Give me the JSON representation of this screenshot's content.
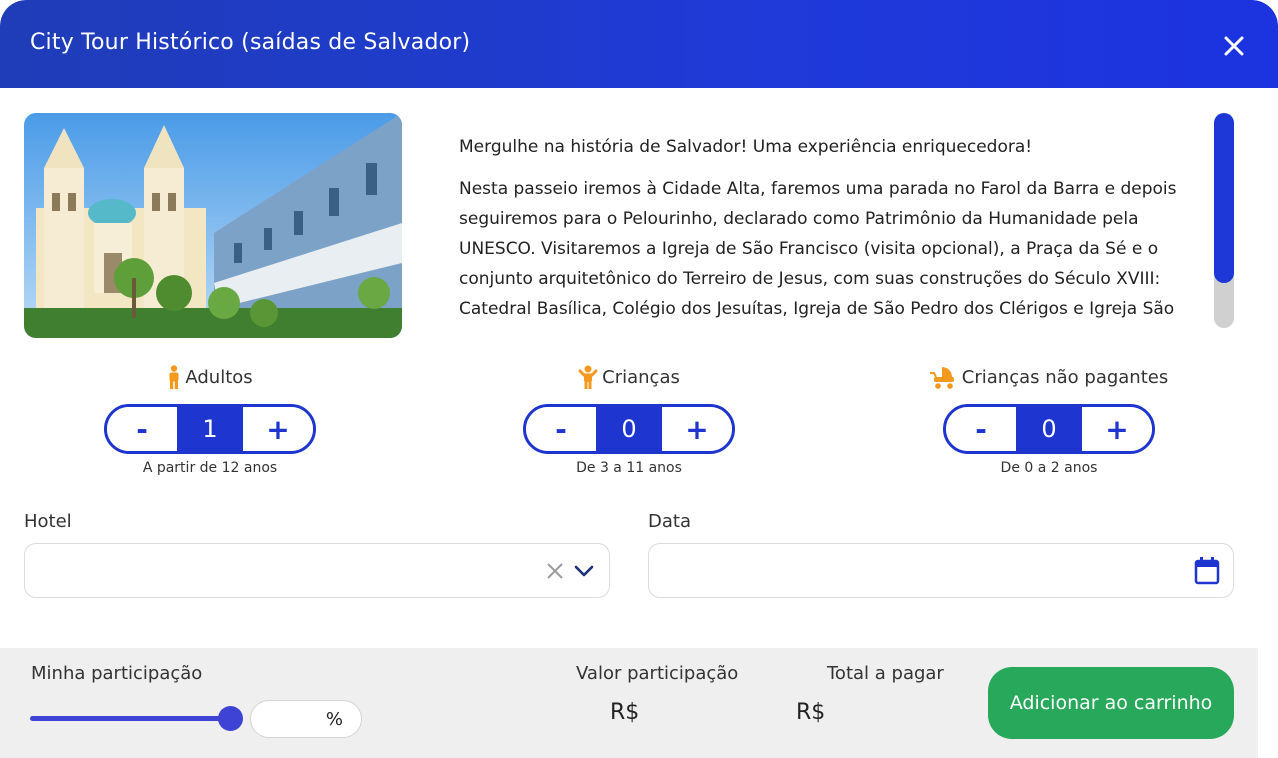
{
  "header": {
    "title": "City Tour Histórico (saídas de Salvador)"
  },
  "description": {
    "paragraph1": "Mergulhe na história de Salvador! Uma experiência enriquecedora!",
    "paragraph2": "Nesta passeio iremos à Cidade Alta, faremos uma parada no Farol da Barra e depois seguiremos para o Pelourinho, declarado como Patrimônio da Humanidade pela UNESCO. Visitaremos a Igreja de São Francisco (visita opcional), a Praça da Sé e o conjunto arquitetônico do Terreiro de Jesus, com suas construções do Século XVIII: Catedral Basílica, Colégio dos Jesuítas, Igreja de São Pedro dos Clérigos e Igreja São"
  },
  "counters": {
    "adults": {
      "label": "Adultos",
      "value": "1",
      "hint": "A partir de 12 anos",
      "minus": "-",
      "plus": "+"
    },
    "children": {
      "label": "Crianças",
      "value": "0",
      "hint": "De 3 a 11 anos",
      "minus": "-",
      "plus": "+"
    },
    "infants": {
      "label": "Crianças não pagantes",
      "value": "0",
      "hint": "De 0 a 2 anos",
      "minus": "-",
      "plus": "+"
    }
  },
  "form": {
    "hotel_label": "Hotel",
    "hotel_value": "",
    "date_label": "Data",
    "date_value": ""
  },
  "footer": {
    "participation_label": "Minha participação",
    "participation_percent": 100,
    "percent_suffix": "%",
    "participation_value_label": "Valor participação",
    "participation_value": "R$",
    "total_label": "Total a pagar",
    "total_value": "R$",
    "cart_button": "Adicionar ao carrinho"
  },
  "colors": {
    "primary": "#1e35d0",
    "cart_green": "#27a85a",
    "icon_orange": "#f39a1e"
  }
}
